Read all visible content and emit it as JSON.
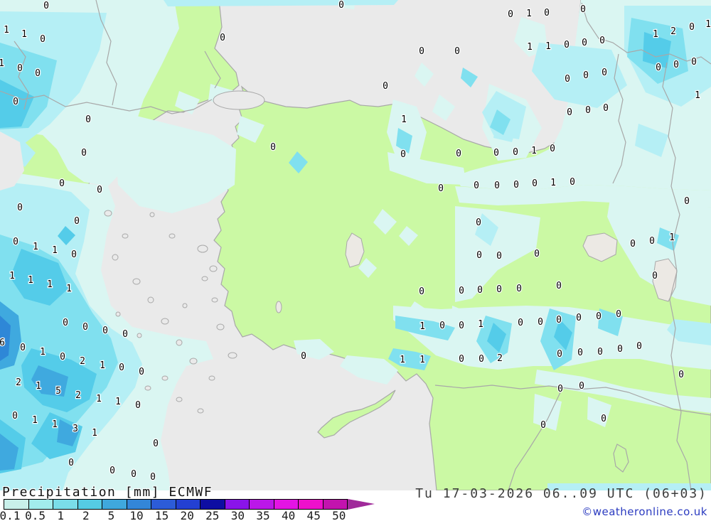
{
  "title": {
    "text": "Precipitation [mm] ECMWF"
  },
  "footer": {
    "datetime": "Tu 17-03-2026 06..09 UTC (06+03)",
    "copyright": "©weatheronline.co.uk"
  },
  "legend": {
    "unit": "mm",
    "model": "ECMWF",
    "arrow_color": "#a02a9a",
    "stops": [
      {
        "label": "0.1",
        "color": "#c9f0ea"
      },
      {
        "label": "0.5",
        "color": "#a2ecec"
      },
      {
        "label": "1",
        "color": "#7adde9"
      },
      {
        "label": "2",
        "color": "#55cbe4"
      },
      {
        "label": "5",
        "color": "#3fa8dd"
      },
      {
        "label": "10",
        "color": "#3386d8"
      },
      {
        "label": "15",
        "color": "#2c5cd8"
      },
      {
        "label": "20",
        "color": "#2340d2"
      },
      {
        "label": "25",
        "color": "#0d0da2"
      },
      {
        "label": "30",
        "color": "#8a14ea"
      },
      {
        "label": "35",
        "color": "#bb17e8"
      },
      {
        "label": "40",
        "color": "#e414e4"
      },
      {
        "label": "45",
        "color": "#ee10cc"
      },
      {
        "label": "50",
        "color": "#c313ae"
      }
    ]
  },
  "map": {
    "palette": {
      "sea": "#eaeaea",
      "land": "#cbf9a4",
      "lake": "#ece9e4",
      "coast": "#a8a8a8",
      "p01": "#daf6f2",
      "p05": "#b5eff5",
      "p1": "#80e0ef",
      "p2": "#54cce9",
      "p5": "#3fa9df",
      "p10": "#2e87d7",
      "arrow": "#a02a9a"
    },
    "values": [
      [
        65,
        8,
        "0"
      ],
      [
        480,
        7,
        "0"
      ],
      [
        9,
        42,
        "1"
      ],
      [
        34,
        48,
        "1"
      ],
      [
        60,
        55,
        "0"
      ],
      [
        313,
        53,
        "0"
      ],
      [
        593,
        72,
        "0"
      ],
      [
        643,
        72,
        "0"
      ],
      [
        718,
        20,
        "0"
      ],
      [
        744,
        19,
        "1"
      ],
      [
        769,
        18,
        "0"
      ],
      [
        820,
        13,
        "0"
      ],
      [
        922,
        48,
        "1"
      ],
      [
        947,
        44,
        "2"
      ],
      [
        973,
        38,
        "0"
      ],
      [
        996,
        34,
        "1"
      ],
      [
        745,
        66,
        "1"
      ],
      [
        771,
        65,
        "1"
      ],
      [
        797,
        63,
        "0"
      ],
      [
        822,
        60,
        "0"
      ],
      [
        847,
        57,
        "0"
      ],
      [
        926,
        95,
        "0"
      ],
      [
        951,
        91,
        "0"
      ],
      [
        976,
        87,
        "0"
      ],
      [
        2,
        89,
        "1"
      ],
      [
        28,
        96,
        "0"
      ],
      [
        53,
        103,
        "0"
      ],
      [
        798,
        111,
        "0"
      ],
      [
        824,
        106,
        "0"
      ],
      [
        850,
        102,
        "0"
      ],
      [
        542,
        121,
        "0"
      ],
      [
        981,
        134,
        "1"
      ],
      [
        22,
        143,
        "0"
      ],
      [
        801,
        158,
        "0"
      ],
      [
        827,
        155,
        "0"
      ],
      [
        852,
        152,
        "0"
      ],
      [
        568,
        168,
        "1"
      ],
      [
        124,
        168,
        "0"
      ],
      [
        384,
        207,
        "0"
      ],
      [
        118,
        215,
        "0"
      ],
      [
        698,
        215,
        "0"
      ],
      [
        725,
        214,
        "0"
      ],
      [
        751,
        212,
        "1"
      ],
      [
        777,
        209,
        "0"
      ],
      [
        567,
        217,
        "0"
      ],
      [
        645,
        216,
        "0"
      ],
      [
        87,
        258,
        "0"
      ],
      [
        140,
        267,
        "0"
      ],
      [
        670,
        261,
        "0"
      ],
      [
        699,
        261,
        "0"
      ],
      [
        726,
        260,
        "0"
      ],
      [
        752,
        258,
        "0"
      ],
      [
        778,
        257,
        "1"
      ],
      [
        805,
        256,
        "0"
      ],
      [
        620,
        265,
        "0"
      ],
      [
        966,
        283,
        "0"
      ],
      [
        28,
        292,
        "0"
      ],
      [
        108,
        311,
        "0"
      ],
      [
        673,
        313,
        "0"
      ],
      [
        890,
        343,
        "0"
      ],
      [
        917,
        339,
        "0"
      ],
      [
        945,
        334,
        "1"
      ],
      [
        22,
        340,
        "0"
      ],
      [
        50,
        347,
        "1"
      ],
      [
        77,
        352,
        "1"
      ],
      [
        104,
        358,
        "0"
      ],
      [
        674,
        359,
        "0"
      ],
      [
        702,
        360,
        "0"
      ],
      [
        755,
        357,
        "0"
      ],
      [
        17,
        388,
        "1"
      ],
      [
        43,
        394,
        "1"
      ],
      [
        70,
        400,
        "1"
      ],
      [
        97,
        406,
        "1"
      ],
      [
        921,
        388,
        "0"
      ],
      [
        593,
        410,
        "0"
      ],
      [
        649,
        409,
        "0"
      ],
      [
        675,
        408,
        "0"
      ],
      [
        702,
        407,
        "0"
      ],
      [
        730,
        406,
        "0"
      ],
      [
        786,
        402,
        "0"
      ],
      [
        92,
        454,
        "0"
      ],
      [
        120,
        460,
        "0"
      ],
      [
        148,
        465,
        "0"
      ],
      [
        176,
        470,
        "0"
      ],
      [
        594,
        459,
        "1"
      ],
      [
        622,
        458,
        "0"
      ],
      [
        649,
        458,
        "0"
      ],
      [
        676,
        456,
        "1"
      ],
      [
        732,
        454,
        "0"
      ],
      [
        760,
        453,
        "0"
      ],
      [
        786,
        450,
        "0"
      ],
      [
        814,
        447,
        "0"
      ],
      [
        842,
        445,
        "0"
      ],
      [
        870,
        442,
        "0"
      ],
      [
        3,
        482,
        "6"
      ],
      [
        32,
        489,
        "0"
      ],
      [
        60,
        495,
        "1"
      ],
      [
        88,
        502,
        "0"
      ],
      [
        116,
        508,
        "2"
      ],
      [
        144,
        514,
        "1"
      ],
      [
        171,
        517,
        "0"
      ],
      [
        199,
        523,
        "0"
      ],
      [
        427,
        501,
        "0"
      ],
      [
        566,
        506,
        "1"
      ],
      [
        594,
        506,
        "1"
      ],
      [
        649,
        505,
        "0"
      ],
      [
        677,
        505,
        "0"
      ],
      [
        703,
        504,
        "2"
      ],
      [
        787,
        498,
        "0"
      ],
      [
        816,
        496,
        "0"
      ],
      [
        844,
        495,
        "0"
      ],
      [
        872,
        491,
        "0"
      ],
      [
        899,
        487,
        "0"
      ],
      [
        958,
        527,
        "0"
      ],
      [
        26,
        538,
        "2"
      ],
      [
        54,
        543,
        "1"
      ],
      [
        82,
        550,
        "5"
      ],
      [
        110,
        556,
        "2"
      ],
      [
        139,
        561,
        "1"
      ],
      [
        166,
        565,
        "1"
      ],
      [
        194,
        570,
        "0"
      ],
      [
        788,
        547,
        "0"
      ],
      [
        818,
        543,
        "0"
      ],
      [
        21,
        585,
        "0"
      ],
      [
        49,
        591,
        "1"
      ],
      [
        77,
        597,
        "1"
      ],
      [
        106,
        603,
        "3"
      ],
      [
        133,
        609,
        "1"
      ],
      [
        849,
        589,
        "0"
      ],
      [
        764,
        598,
        "0"
      ],
      [
        219,
        624,
        "0"
      ],
      [
        100,
        651,
        "0"
      ],
      [
        158,
        662,
        "0"
      ],
      [
        188,
        667,
        "0"
      ],
      [
        215,
        671,
        "0"
      ]
    ]
  }
}
